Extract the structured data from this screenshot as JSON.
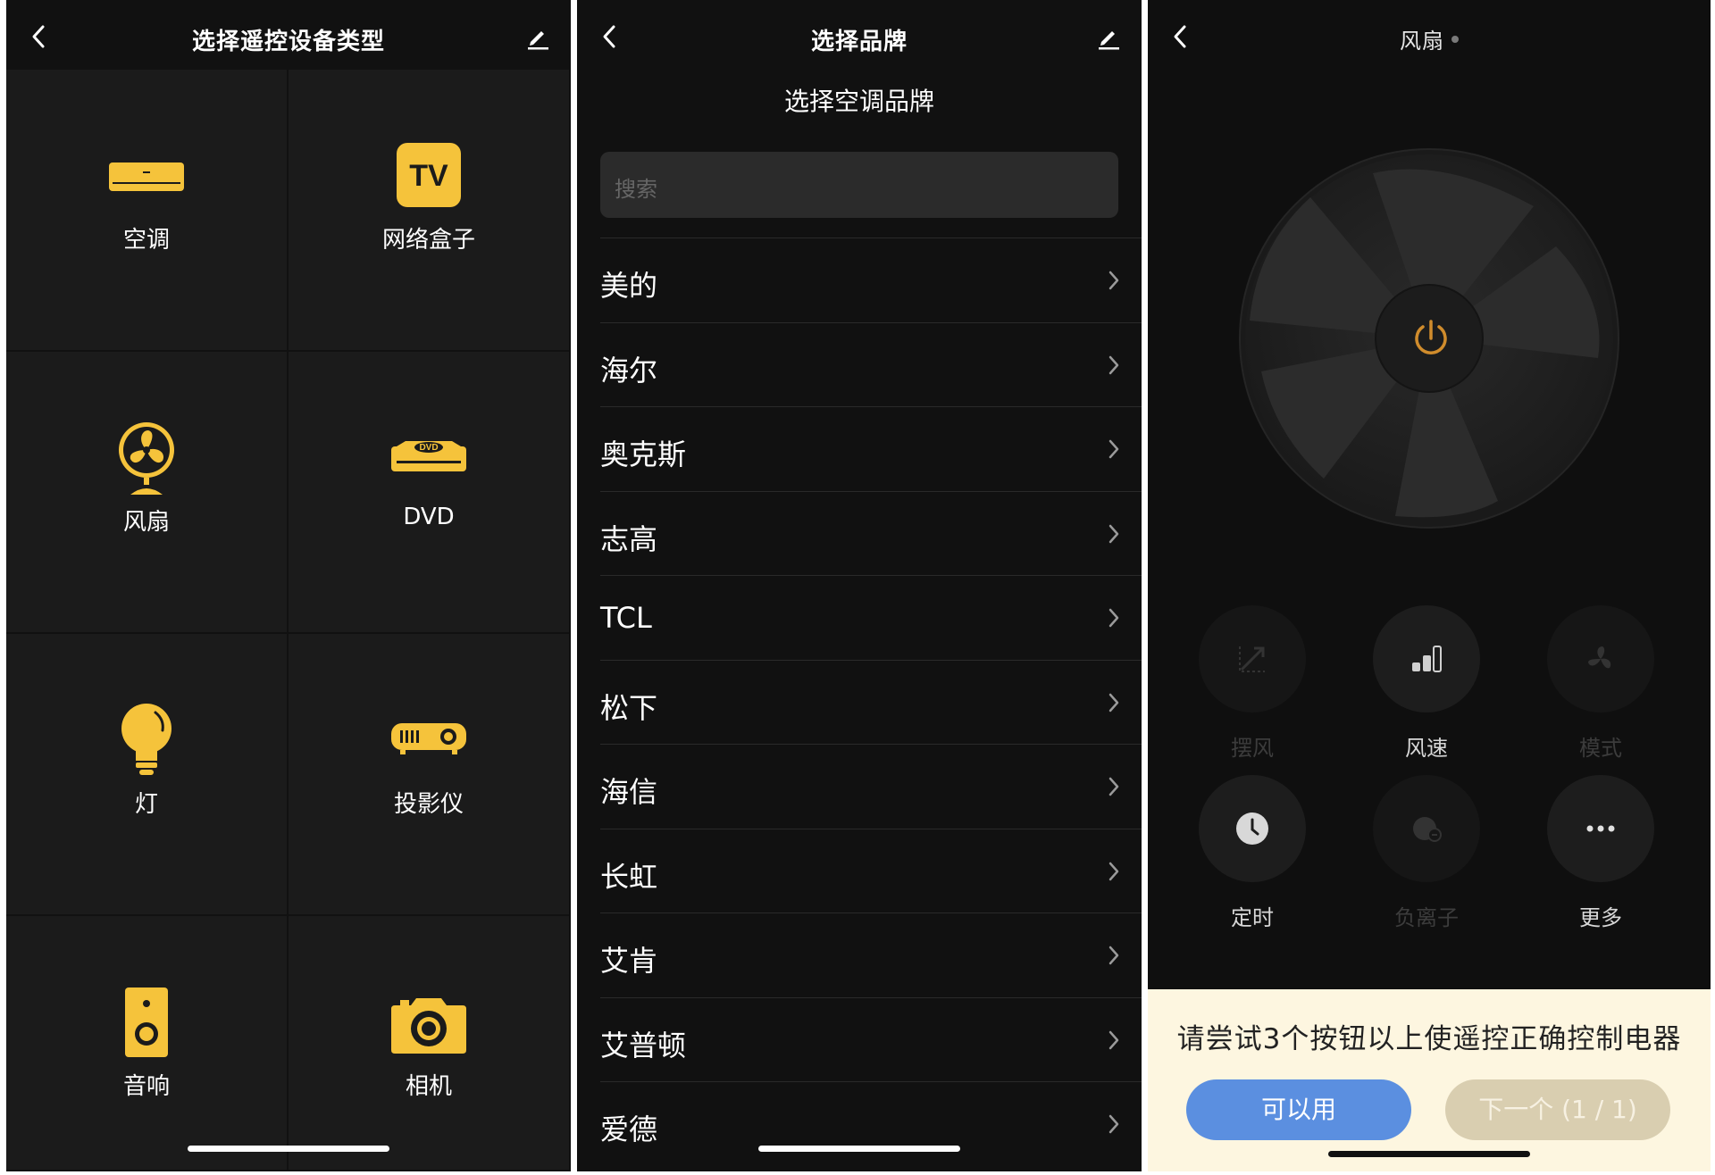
{
  "colors": {
    "accent": "#F5C33B",
    "background": "#111111",
    "cell": "#1b1b1b",
    "primary_button": "#5b8fe0",
    "secondary_button": "#d9ceb0",
    "tip_bg": "#fdf6e0"
  },
  "panel1": {
    "title": "选择遥控设备类型",
    "devices": [
      {
        "label": "空调",
        "icon": "air-conditioner-icon"
      },
      {
        "label": "网络盒子",
        "icon": "tv-box-icon",
        "icon_text": "TV"
      },
      {
        "label": "风扇",
        "icon": "fan-icon"
      },
      {
        "label": "DVD",
        "icon": "dvd-icon",
        "icon_text": "DVD"
      },
      {
        "label": "灯",
        "icon": "light-bulb-icon"
      },
      {
        "label": "投影仪",
        "icon": "projector-icon"
      },
      {
        "label": "音响",
        "icon": "speaker-icon"
      },
      {
        "label": "相机",
        "icon": "camera-icon"
      }
    ]
  },
  "panel2": {
    "title": "选择品牌",
    "subtitle": "选择空调品牌",
    "search_placeholder": "搜索",
    "brands": [
      "美的",
      "海尔",
      "奥克斯",
      "志高",
      "TCL",
      "松下",
      "海信",
      "长虹",
      "艾肯",
      "艾普顿",
      "爱德"
    ]
  },
  "panel3": {
    "title": "风扇",
    "controls": [
      {
        "label": "摆风",
        "icon": "swing-icon",
        "enabled": false
      },
      {
        "label": "风速",
        "icon": "fan-speed-icon",
        "enabled": true
      },
      {
        "label": "模式",
        "icon": "mode-icon",
        "enabled": false
      },
      {
        "label": "定时",
        "icon": "timer-icon",
        "enabled": true
      },
      {
        "label": "负离子",
        "icon": "anion-icon",
        "enabled": false
      },
      {
        "label": "更多",
        "icon": "more-icon",
        "enabled": true
      }
    ],
    "tip": "请尝试3个按钮以上使遥控正确控制电器",
    "confirm_label": "可以用",
    "next_label": "下一个 (1 / 1)"
  }
}
